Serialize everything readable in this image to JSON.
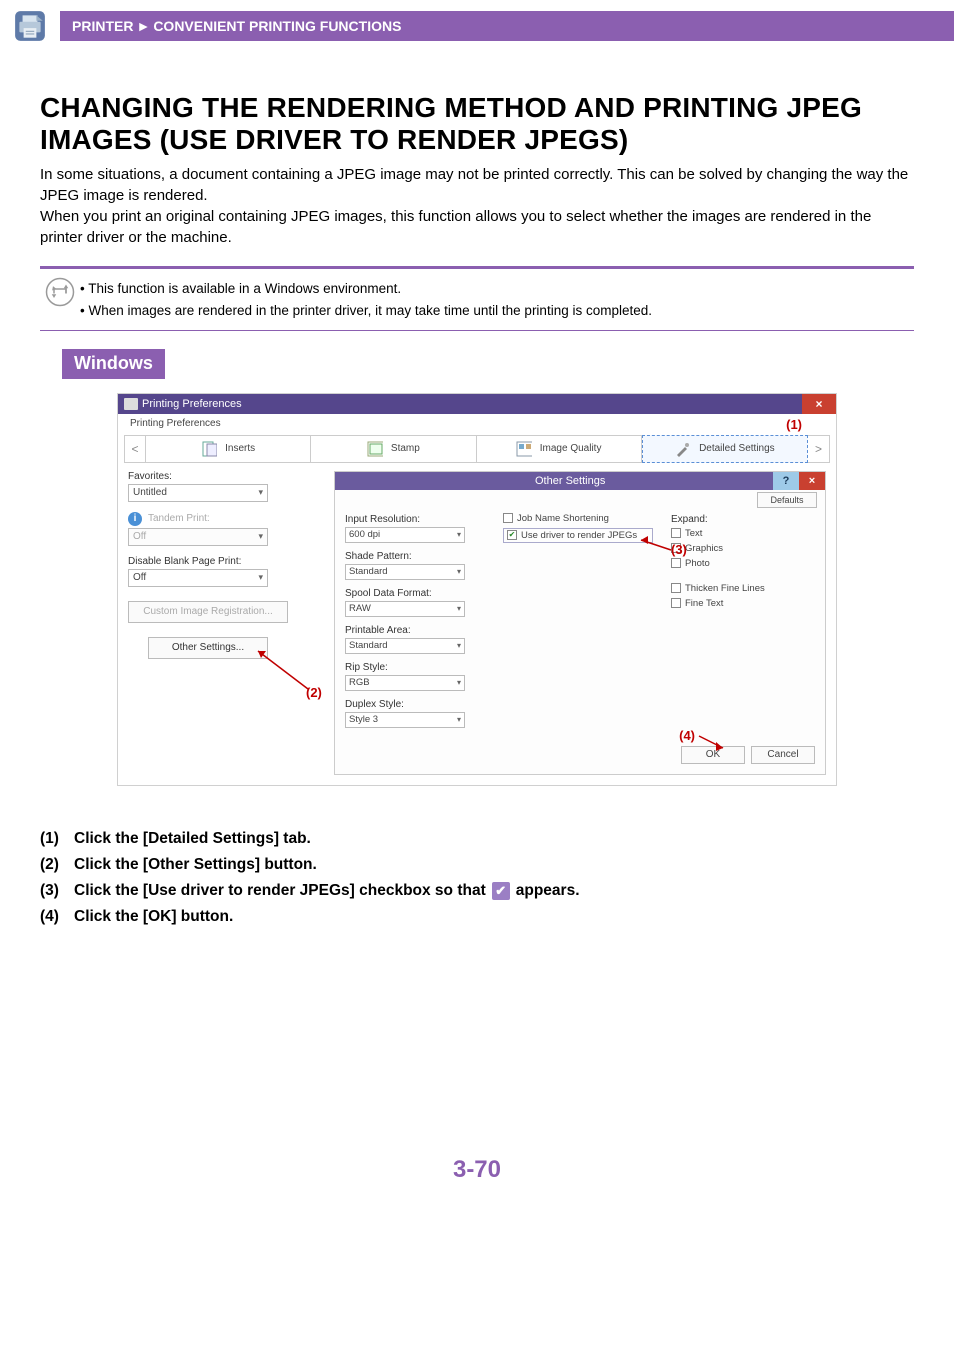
{
  "breadcrumb": {
    "section": "PRINTER",
    "page": "CONVENIENT PRINTING FUNCTIONS"
  },
  "heading": "CHANGING THE RENDERING METHOD AND PRINTING JPEG IMAGES (USE DRIVER TO RENDER JPEGS)",
  "intro1": "In some situations, a document containing a JPEG image may not be printed correctly. This can be solved by changing the way the JPEG image is rendered.",
  "intro2": "When you print an original containing JPEG images, this function allows you to select whether the images are rendered in the printer driver or the machine.",
  "notes": {
    "n1": "• This function is available in a Windows environment.",
    "n2": "• When images are rendered in the printer driver, it may take time until the printing is completed."
  },
  "os_label": "Windows",
  "dialog": {
    "title": "Printing Preferences",
    "tab_header": "Printing Preferences",
    "tabs": {
      "inserts": "Inserts",
      "stamp": "Stamp",
      "image_quality": "Image Quality",
      "detailed": "Detailed Settings"
    },
    "left": {
      "favorites_label": "Favorites:",
      "favorites_value": "Untitled",
      "tandem_label": "Tandem Print:",
      "tandem_value": "Off",
      "disable_blank_label": "Disable Blank Page Print:",
      "disable_blank_value": "Off",
      "custom_image_btn": "Custom Image Registration...",
      "other_settings_btn": "Other Settings..."
    },
    "panel": {
      "title": "Other Settings",
      "defaults": "Defaults",
      "input_res_label": "Input Resolution:",
      "input_res_value": "600 dpi",
      "shade_label": "Shade Pattern:",
      "shade_value": "Standard",
      "spool_label": "Spool Data Format:",
      "spool_value": "RAW",
      "printable_label": "Printable Area:",
      "printable_value": "Standard",
      "rip_label": "Rip Style:",
      "rip_value": "RGB",
      "duplex_label": "Duplex Style:",
      "duplex_value": "Style 3",
      "chk_job_name": "Job Name Shortening",
      "chk_use_driver": "Use driver to render JPEGs",
      "expand_label": "Expand:",
      "chk_text": "Text",
      "chk_graphics": "Graphics",
      "chk_photo": "Photo",
      "chk_thicken": "Thicken Fine Lines",
      "chk_fine_text": "Fine Text",
      "ok": "OK",
      "cancel": "Cancel"
    }
  },
  "callouts": {
    "c1": "(1)",
    "c2": "(2)",
    "c3": "(3)",
    "c4": "(4)"
  },
  "steps": {
    "s1_num": "(1)",
    "s1_text": "Click the [Detailed Settings] tab.",
    "s2_num": "(2)",
    "s2_text": "Click the [Other Settings] button.",
    "s3_num": "(3)",
    "s3_pre": "Click the [Use driver to render JPEGs] checkbox so that ",
    "s3_post": " appears.",
    "s4_num": "(4)",
    "s4_text": "Click the [OK] button."
  },
  "page_number": "3-70"
}
